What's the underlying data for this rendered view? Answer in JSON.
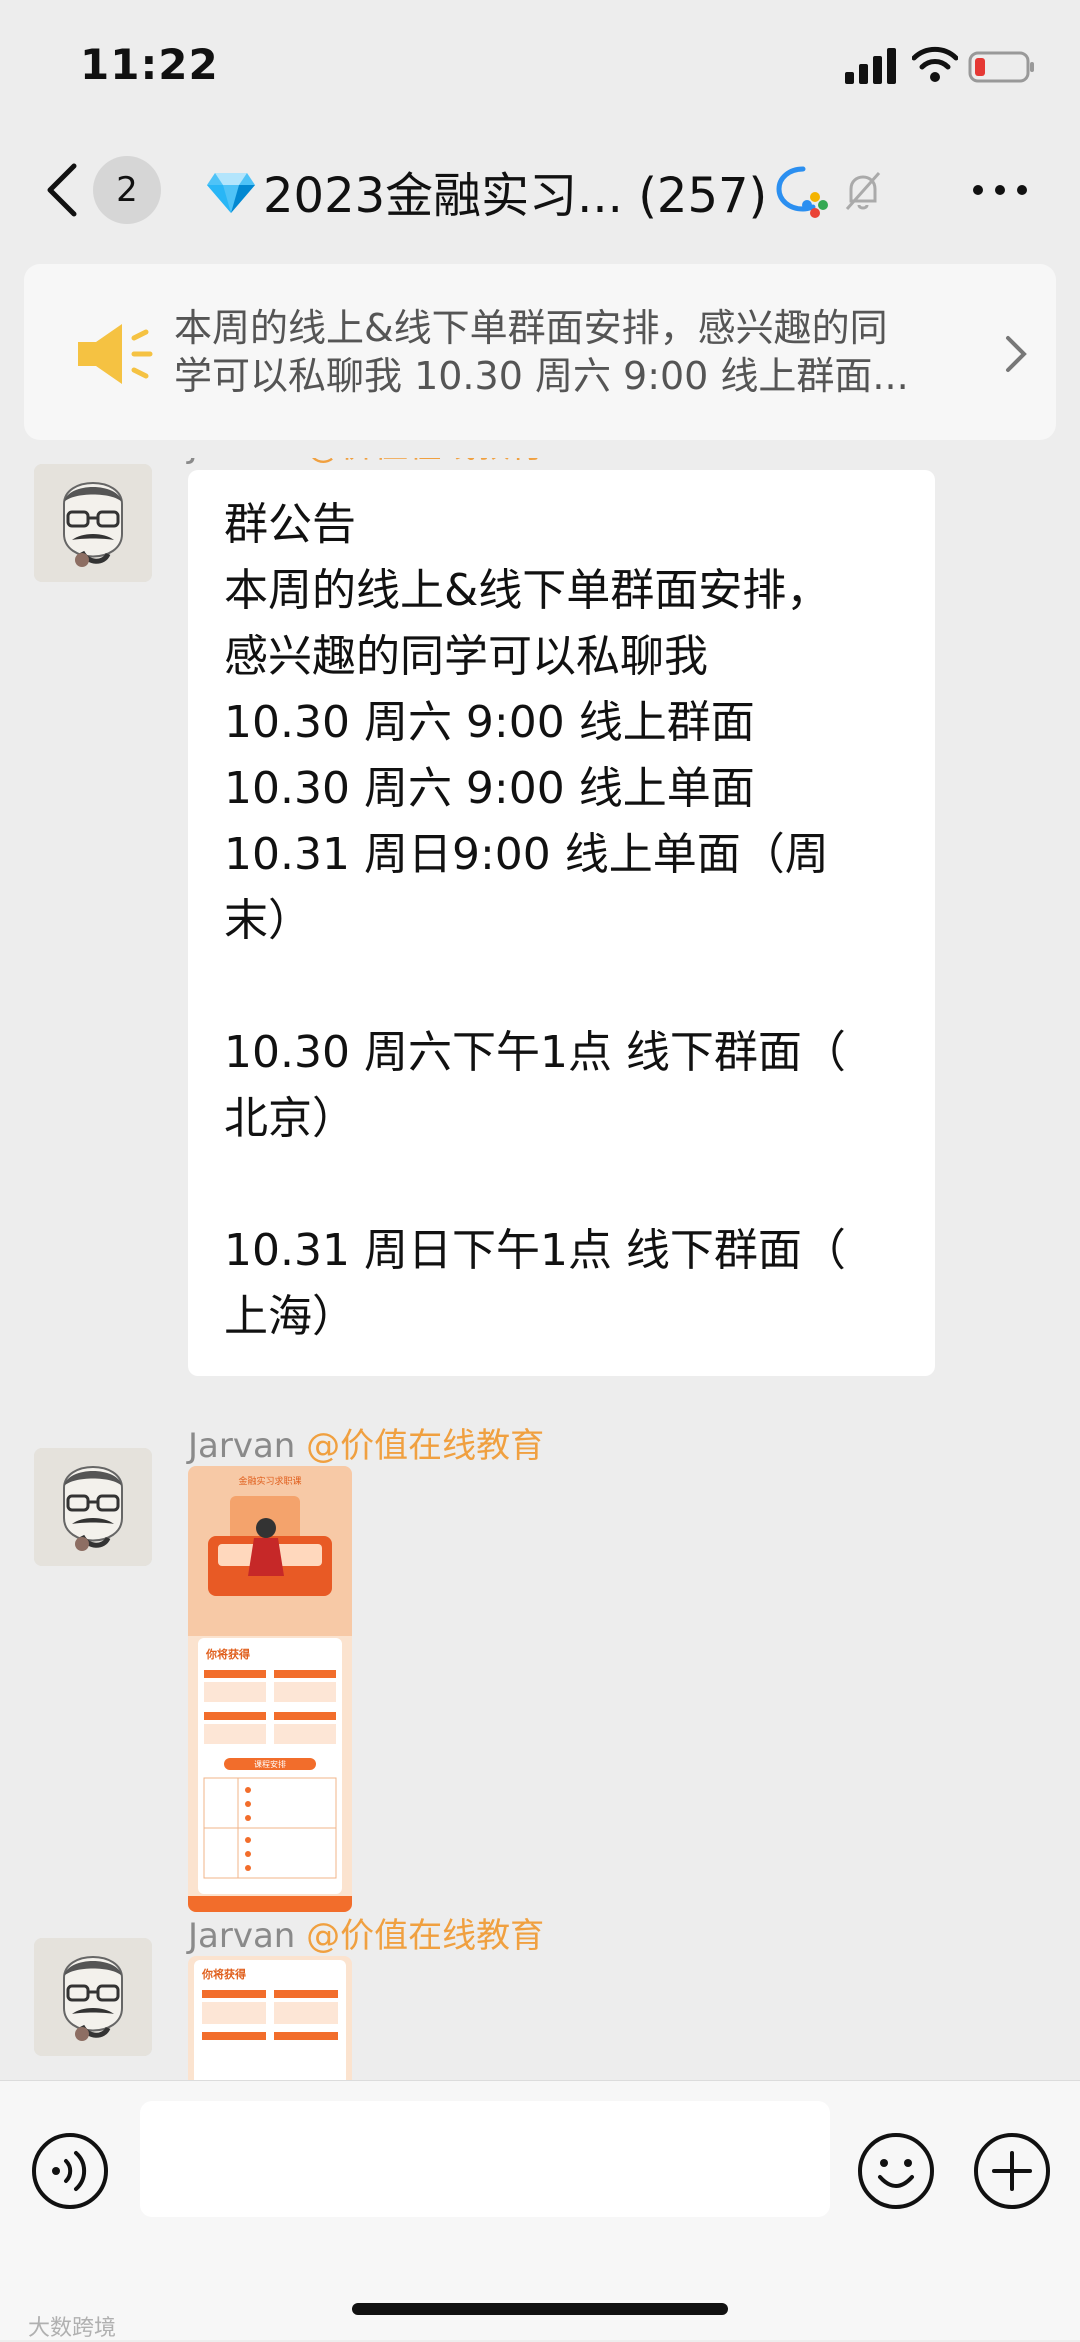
{
  "status": {
    "time": "11:22"
  },
  "nav": {
    "unread_count": "2",
    "title": "2023金融实习... (257)"
  },
  "notice": {
    "line1": "本周的线上&线下单群面安排，感兴趣的同",
    "line2": "学可以私聊我 10.30 周六 9:00 线上群面..."
  },
  "messages": [
    {
      "sender": "Jarvan",
      "org": "@价值在线教育",
      "lines": [
        "群公告",
        "本周的线上&线下单群面安排，",
        "感兴趣的同学可以私聊我",
        "10.30 周六 9:00 线上群面",
        "10.30 周六 9:00 线上单面",
        "10.31 周日9:00 线上单面（周",
        "末）",
        "",
        "10.30 周六下午1点 线下群面（",
        "北京）",
        "",
        "10.31 周日下午1点 线下群面（",
        "上海）"
      ]
    },
    {
      "sender": "Jarvan",
      "org": "@价值在线教育",
      "image": {
        "heading": "你将获得",
        "section": "课程安排",
        "banner": "金融实习求职课"
      }
    },
    {
      "sender": "Jarvan",
      "org": "@价值在线教育",
      "image": {
        "heading": "你将获得"
      }
    }
  ],
  "watermark": "大数跨境",
  "colors": {
    "background": "#ededed",
    "org": "#f0a040",
    "speaker": "#f5c242",
    "image_orange": "#f26d2b"
  }
}
